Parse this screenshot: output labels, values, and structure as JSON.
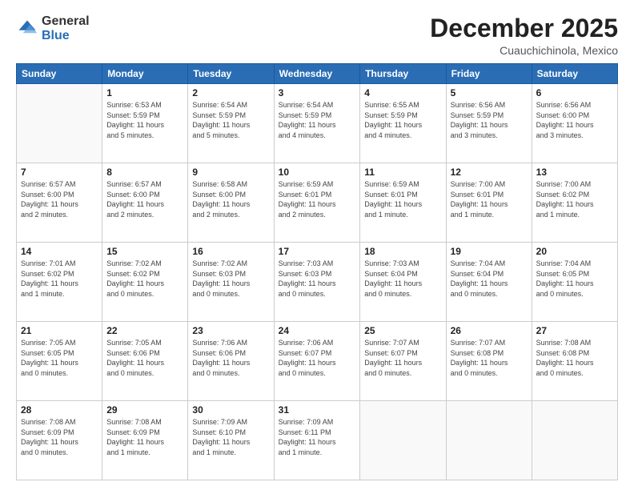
{
  "logo": {
    "general": "General",
    "blue": "Blue"
  },
  "header": {
    "title": "December 2025",
    "subtitle": "Cuauchichinola, Mexico"
  },
  "weekdays": [
    "Sunday",
    "Monday",
    "Tuesday",
    "Wednesday",
    "Thursday",
    "Friday",
    "Saturday"
  ],
  "weeks": [
    [
      {
        "day": "",
        "info": ""
      },
      {
        "day": "1",
        "info": "Sunrise: 6:53 AM\nSunset: 5:59 PM\nDaylight: 11 hours\nand 5 minutes."
      },
      {
        "day": "2",
        "info": "Sunrise: 6:54 AM\nSunset: 5:59 PM\nDaylight: 11 hours\nand 5 minutes."
      },
      {
        "day": "3",
        "info": "Sunrise: 6:54 AM\nSunset: 5:59 PM\nDaylight: 11 hours\nand 4 minutes."
      },
      {
        "day": "4",
        "info": "Sunrise: 6:55 AM\nSunset: 5:59 PM\nDaylight: 11 hours\nand 4 minutes."
      },
      {
        "day": "5",
        "info": "Sunrise: 6:56 AM\nSunset: 5:59 PM\nDaylight: 11 hours\nand 3 minutes."
      },
      {
        "day": "6",
        "info": "Sunrise: 6:56 AM\nSunset: 6:00 PM\nDaylight: 11 hours\nand 3 minutes."
      }
    ],
    [
      {
        "day": "7",
        "info": "Sunrise: 6:57 AM\nSunset: 6:00 PM\nDaylight: 11 hours\nand 2 minutes."
      },
      {
        "day": "8",
        "info": "Sunrise: 6:57 AM\nSunset: 6:00 PM\nDaylight: 11 hours\nand 2 minutes."
      },
      {
        "day": "9",
        "info": "Sunrise: 6:58 AM\nSunset: 6:00 PM\nDaylight: 11 hours\nand 2 minutes."
      },
      {
        "day": "10",
        "info": "Sunrise: 6:59 AM\nSunset: 6:01 PM\nDaylight: 11 hours\nand 2 minutes."
      },
      {
        "day": "11",
        "info": "Sunrise: 6:59 AM\nSunset: 6:01 PM\nDaylight: 11 hours\nand 1 minute."
      },
      {
        "day": "12",
        "info": "Sunrise: 7:00 AM\nSunset: 6:01 PM\nDaylight: 11 hours\nand 1 minute."
      },
      {
        "day": "13",
        "info": "Sunrise: 7:00 AM\nSunset: 6:02 PM\nDaylight: 11 hours\nand 1 minute."
      }
    ],
    [
      {
        "day": "14",
        "info": "Sunrise: 7:01 AM\nSunset: 6:02 PM\nDaylight: 11 hours\nand 1 minute."
      },
      {
        "day": "15",
        "info": "Sunrise: 7:02 AM\nSunset: 6:02 PM\nDaylight: 11 hours\nand 0 minutes."
      },
      {
        "day": "16",
        "info": "Sunrise: 7:02 AM\nSunset: 6:03 PM\nDaylight: 11 hours\nand 0 minutes."
      },
      {
        "day": "17",
        "info": "Sunrise: 7:03 AM\nSunset: 6:03 PM\nDaylight: 11 hours\nand 0 minutes."
      },
      {
        "day": "18",
        "info": "Sunrise: 7:03 AM\nSunset: 6:04 PM\nDaylight: 11 hours\nand 0 minutes."
      },
      {
        "day": "19",
        "info": "Sunrise: 7:04 AM\nSunset: 6:04 PM\nDaylight: 11 hours\nand 0 minutes."
      },
      {
        "day": "20",
        "info": "Sunrise: 7:04 AM\nSunset: 6:05 PM\nDaylight: 11 hours\nand 0 minutes."
      }
    ],
    [
      {
        "day": "21",
        "info": "Sunrise: 7:05 AM\nSunset: 6:05 PM\nDaylight: 11 hours\nand 0 minutes."
      },
      {
        "day": "22",
        "info": "Sunrise: 7:05 AM\nSunset: 6:06 PM\nDaylight: 11 hours\nand 0 minutes."
      },
      {
        "day": "23",
        "info": "Sunrise: 7:06 AM\nSunset: 6:06 PM\nDaylight: 11 hours\nand 0 minutes."
      },
      {
        "day": "24",
        "info": "Sunrise: 7:06 AM\nSunset: 6:07 PM\nDaylight: 11 hours\nand 0 minutes."
      },
      {
        "day": "25",
        "info": "Sunrise: 7:07 AM\nSunset: 6:07 PM\nDaylight: 11 hours\nand 0 minutes."
      },
      {
        "day": "26",
        "info": "Sunrise: 7:07 AM\nSunset: 6:08 PM\nDaylight: 11 hours\nand 0 minutes."
      },
      {
        "day": "27",
        "info": "Sunrise: 7:08 AM\nSunset: 6:08 PM\nDaylight: 11 hours\nand 0 minutes."
      }
    ],
    [
      {
        "day": "28",
        "info": "Sunrise: 7:08 AM\nSunset: 6:09 PM\nDaylight: 11 hours\nand 0 minutes."
      },
      {
        "day": "29",
        "info": "Sunrise: 7:08 AM\nSunset: 6:09 PM\nDaylight: 11 hours\nand 1 minute."
      },
      {
        "day": "30",
        "info": "Sunrise: 7:09 AM\nSunset: 6:10 PM\nDaylight: 11 hours\nand 1 minute."
      },
      {
        "day": "31",
        "info": "Sunrise: 7:09 AM\nSunset: 6:11 PM\nDaylight: 11 hours\nand 1 minute."
      },
      {
        "day": "",
        "info": ""
      },
      {
        "day": "",
        "info": ""
      },
      {
        "day": "",
        "info": ""
      }
    ]
  ]
}
